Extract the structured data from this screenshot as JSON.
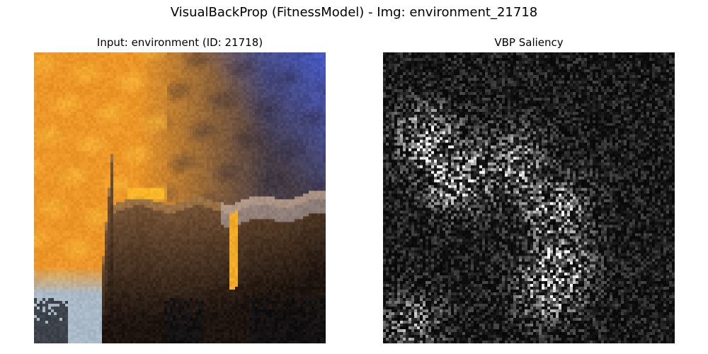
{
  "figure": {
    "suptitle": "VisualBackProp (FitnessModel) - Img: environment_21718"
  },
  "panels": [
    {
      "title": "Input: environment (ID: 21718)",
      "content": "photo",
      "colormap": "rgb"
    },
    {
      "title": "VBP Saliency",
      "content": "saliency-heatmap",
      "colormap": "gray"
    }
  ]
}
